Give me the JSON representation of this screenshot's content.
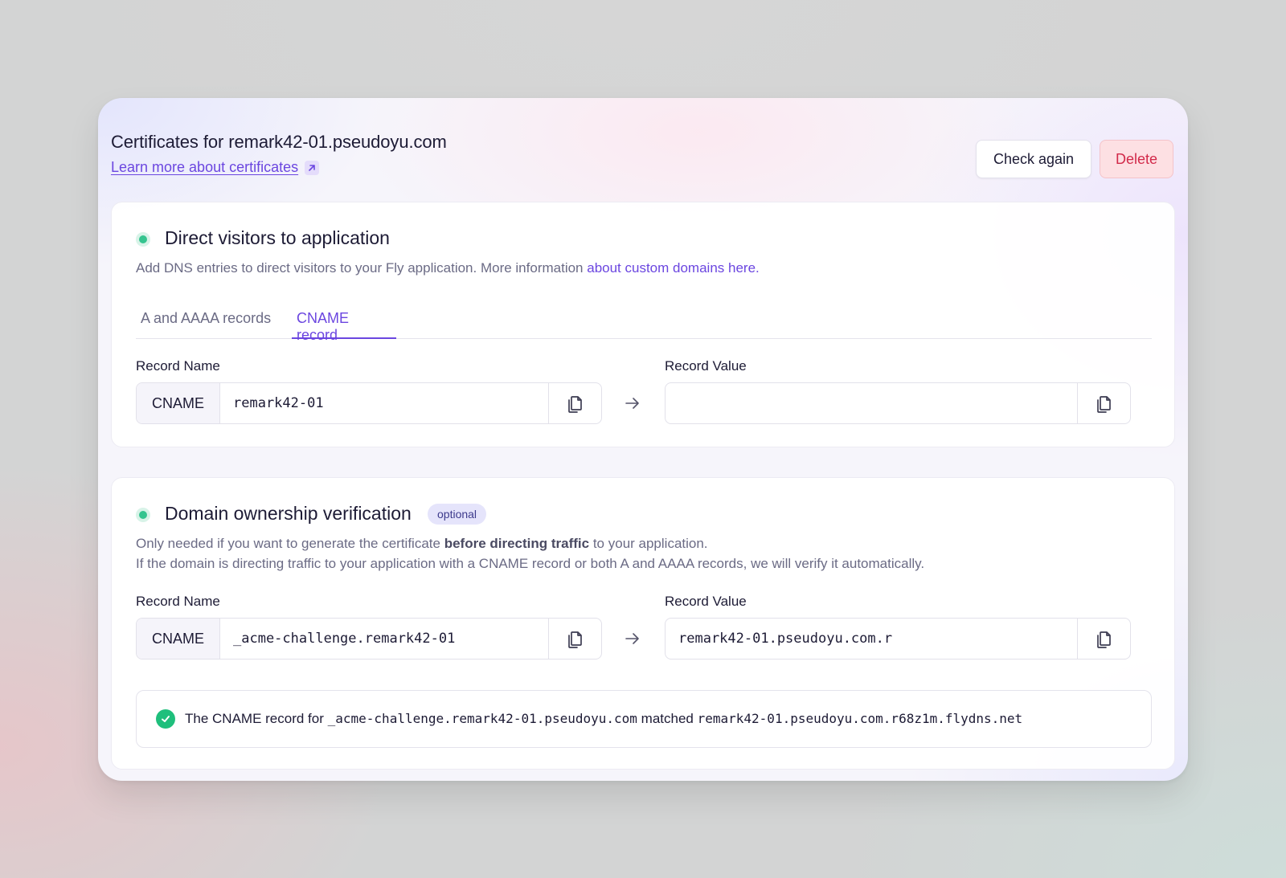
{
  "header": {
    "title": "Certificates for remark42-01.pseudoyu.com",
    "learn_link": "Learn more about certificates",
    "check_again": "Check again",
    "delete": "Delete"
  },
  "direct": {
    "title": "Direct visitors to application",
    "desc_text": "Add DNS entries to direct visitors to your Fly application. More information ",
    "desc_link": "about custom domains here.",
    "tabs": [
      "A and AAAA records",
      "CNAME record"
    ],
    "active_tab": "CNAME record",
    "record_name_label": "Record Name",
    "record_value_label": "Record Value",
    "record_type": "CNAME",
    "record_name": "remark42-01",
    "record_value": ""
  },
  "ownership": {
    "title": "Domain ownership verification",
    "badge": "optional",
    "desc_line1_a": "Only needed if you want to generate the certificate ",
    "desc_line1_bold": "before directing traffic",
    "desc_line1_b": " to your application.",
    "desc_line2": "If the domain is directing traffic to your application with a CNAME record or both A and AAAA records, we will verify it automatically.",
    "record_name_label": "Record Name",
    "record_value_label": "Record Value",
    "record_type": "CNAME",
    "record_name": "_acme-challenge.remark42-01",
    "record_value": "remark42-01.pseudoyu.com.r",
    "match": {
      "prefix": "The CNAME record for",
      "name": "_acme-challenge.remark42-01.pseudoyu.com",
      "middle": "matched",
      "value": "remark42-01.pseudoyu.com.r68z1m.flydns.net"
    }
  },
  "colors": {
    "accent": "#6b46e0",
    "success": "#1fbf7c",
    "danger": "#d22a4a"
  }
}
